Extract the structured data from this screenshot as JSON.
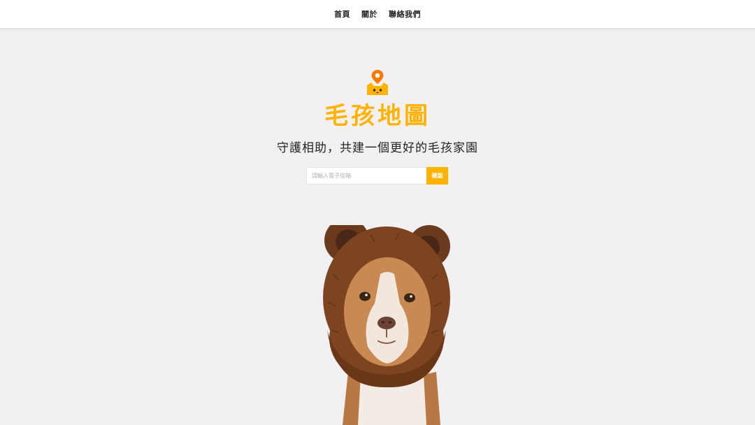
{
  "nav": {
    "items": [
      {
        "label": "首頁"
      },
      {
        "label": "關於"
      },
      {
        "label": "聯絡我們"
      }
    ]
  },
  "hero": {
    "title": "毛孩地圖",
    "subtitle": "守護相助，共建一個更好的毛孩家園"
  },
  "subscribe": {
    "placeholder": "請輸入電子信箱",
    "value": "",
    "button_label": "確認"
  },
  "colors": {
    "accent": "#ffb300",
    "pin": "#f57c00",
    "background": "#f2f0f2",
    "text": "#222222"
  },
  "icons": {
    "logo": "location-pin-cat-icon"
  },
  "image": {
    "subject": "dog-in-bear-hat-image"
  }
}
